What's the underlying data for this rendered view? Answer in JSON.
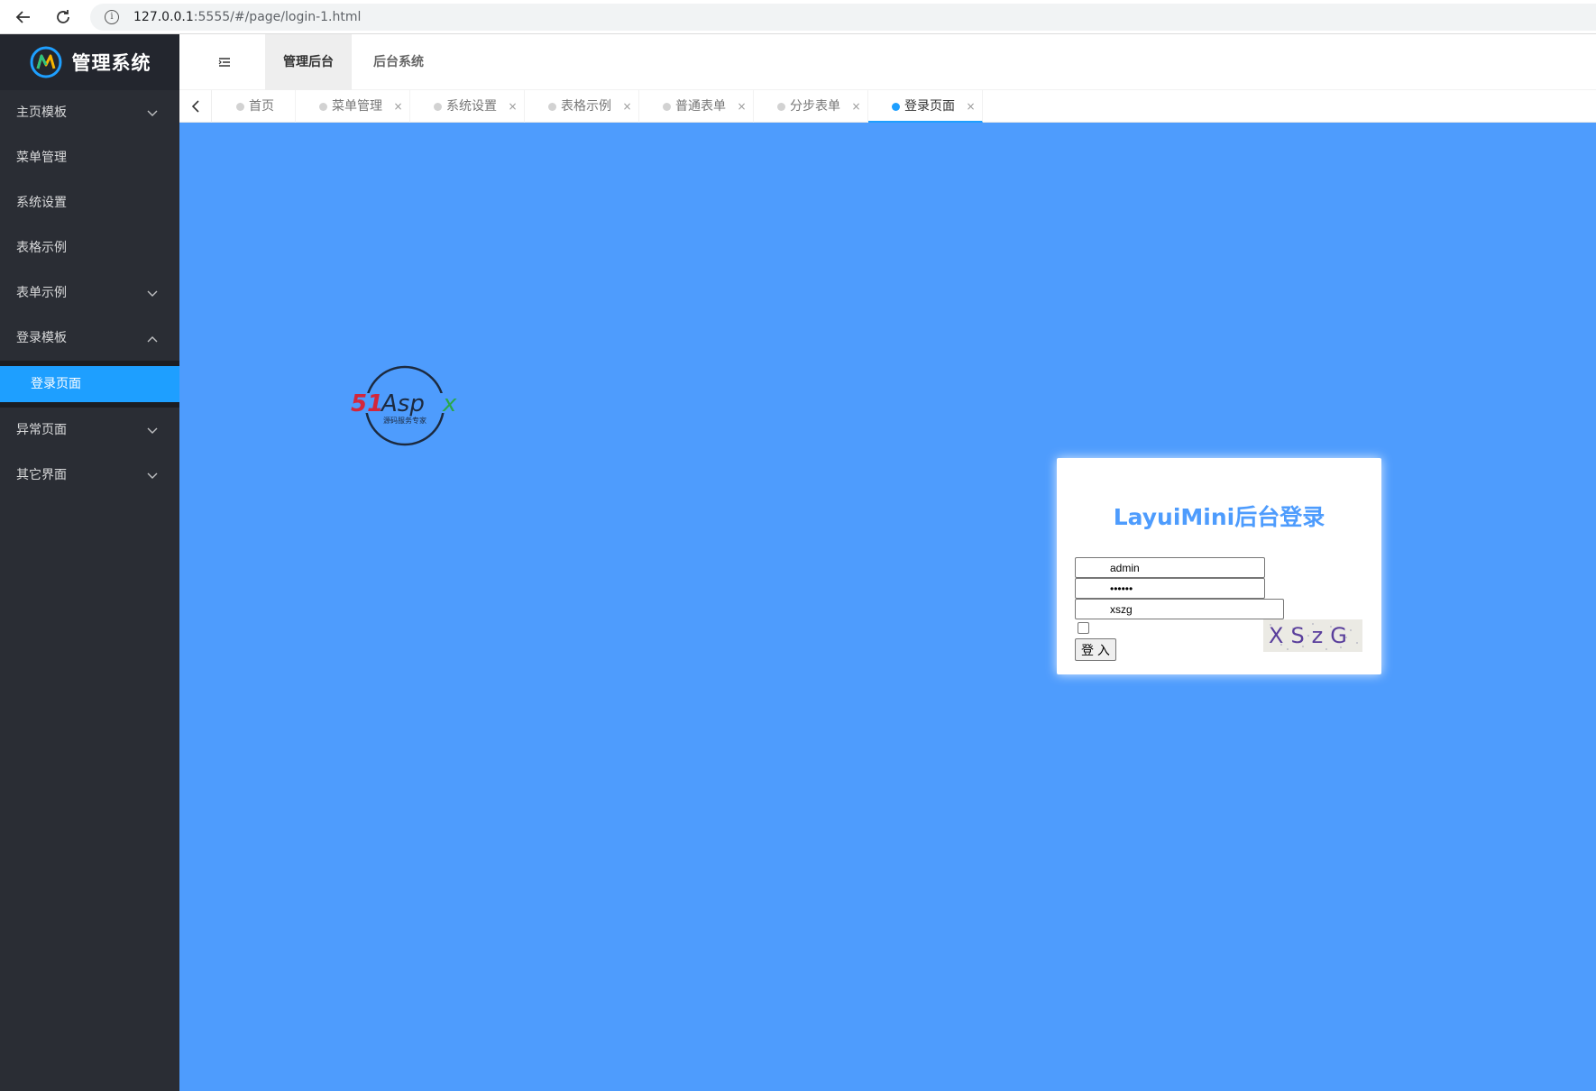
{
  "browser": {
    "url_host": "127.0.0.1",
    "url_path": ":5555/#/page/login-1.html"
  },
  "sidebar": {
    "logo_text": "管理系统",
    "items": [
      {
        "label": "主页模板",
        "has_chevron": true
      },
      {
        "label": "菜单管理",
        "has_chevron": false
      },
      {
        "label": "系统设置",
        "has_chevron": false
      },
      {
        "label": "表格示例",
        "has_chevron": false
      },
      {
        "label": "表单示例",
        "has_chevron": true
      },
      {
        "label": "登录模板",
        "has_chevron": true,
        "expanded": true
      },
      {
        "label": "异常页面",
        "has_chevron": true
      },
      {
        "label": "其它界面",
        "has_chevron": true
      }
    ],
    "submenu_active": "登录页面"
  },
  "header": {
    "tabs": [
      "管理后台",
      "后台系统"
    ]
  },
  "tabbar": {
    "tabs": [
      {
        "label": "首页",
        "closable": false
      },
      {
        "label": "菜单管理",
        "closable": true
      },
      {
        "label": "系统设置",
        "closable": true
      },
      {
        "label": "表格示例",
        "closable": true
      },
      {
        "label": "普通表单",
        "closable": true
      },
      {
        "label": "分步表单",
        "closable": true
      },
      {
        "label": "登录页面",
        "closable": true,
        "active": true
      }
    ],
    "close_glyph": "×"
  },
  "content": {
    "background": "#4e9cfd",
    "watermark_text": "51Aspx",
    "watermark_sub": "源码服务专家"
  },
  "login": {
    "title": "LayuiMini后台登录",
    "username": "admin",
    "password": "••••••",
    "captcha_value": "xszg",
    "captcha_text": "XSzG",
    "submit_label": "登 入"
  },
  "colors": {
    "accent": "#1e9fff",
    "sidebar_bg": "#2a2d34",
    "title_color": "#4e9cfd"
  }
}
